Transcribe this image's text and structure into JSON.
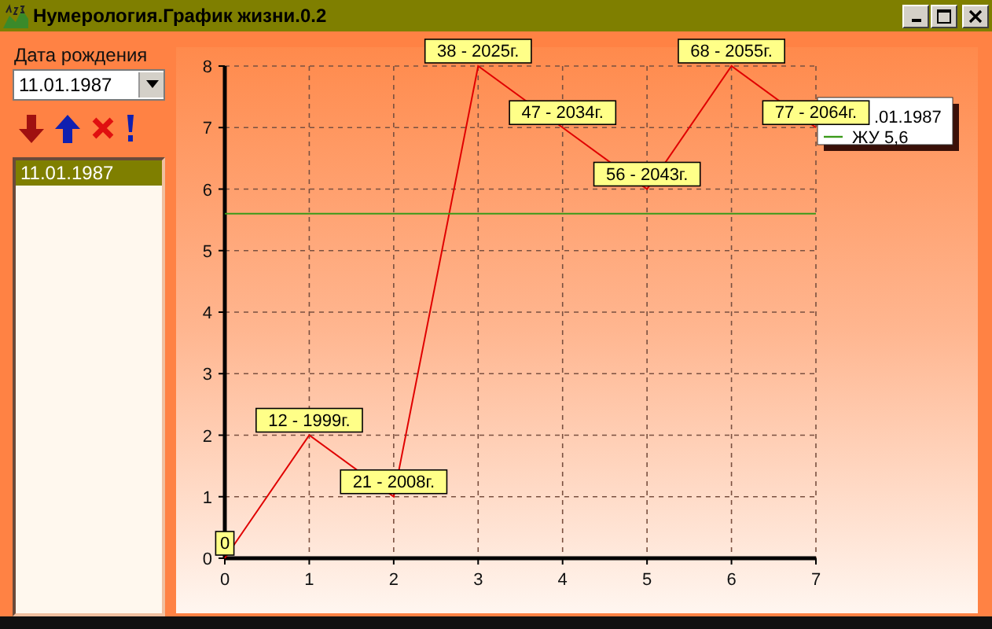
{
  "window": {
    "title": "Нумерология.График жизни.0.2"
  },
  "sidebar": {
    "birth_date_label": "Дата рождения",
    "date_combo": {
      "value": "11.01.1987"
    },
    "list": [
      {
        "label": "11.01.1987",
        "selected": true
      }
    ]
  },
  "chart": {
    "chart_data": {
      "type": "line",
      "grid": true,
      "x": [
        0,
        1,
        2,
        3,
        4,
        5,
        6,
        7
      ],
      "series": [
        {
          "name": ".01.1987",
          "color": "#e00000",
          "values": [
            0,
            2,
            1,
            8,
            7,
            6,
            8,
            7
          ]
        },
        {
          "name": "ЖУ 5,6",
          "color": "#3a9a1a",
          "values": [
            5.6,
            5.6,
            5.6,
            5.6,
            5.6,
            5.6,
            5.6,
            5.6
          ]
        }
      ],
      "xlim": [
        0,
        7
      ],
      "ylim": [
        0,
        8
      ],
      "xticks": [
        0,
        1,
        2,
        3,
        4,
        5,
        6,
        7
      ],
      "yticks": [
        0,
        1,
        2,
        3,
        4,
        5,
        6,
        7,
        8
      ],
      "annotations": [
        {
          "x": 0,
          "y": 0,
          "text": "0"
        },
        {
          "x": 1,
          "y": 2,
          "text": "12 - 1999г."
        },
        {
          "x": 2,
          "y": 1,
          "text": "21 - 2008г."
        },
        {
          "x": 3,
          "y": 8,
          "text": "38 - 2025г."
        },
        {
          "x": 4,
          "y": 7,
          "text": "47 - 2034г."
        },
        {
          "x": 5,
          "y": 6,
          "text": "56 - 2043г."
        },
        {
          "x": 6,
          "y": 8,
          "text": "68 - 2055г."
        },
        {
          "x": 7,
          "y": 7,
          "text": "77 - 2064г."
        }
      ]
    }
  }
}
